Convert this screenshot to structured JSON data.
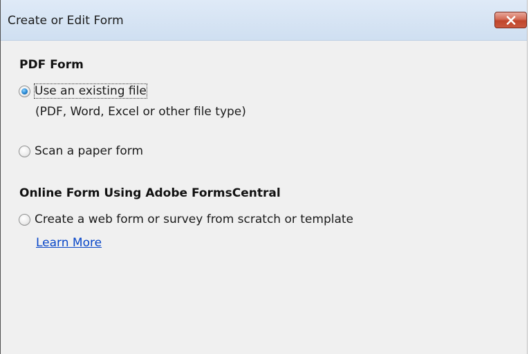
{
  "window": {
    "title": "Create or Edit Form",
    "close_icon": "close-icon"
  },
  "pdf_form": {
    "heading": "PDF Form",
    "options": [
      {
        "label": "Use an existing file",
        "description": "(PDF, Word, Excel or other file type)",
        "selected": true
      },
      {
        "label": "Scan a paper form",
        "selected": false
      }
    ]
  },
  "online_form": {
    "heading": "Online Form Using Adobe FormsCentral",
    "options": [
      {
        "label": "Create a web form or survey from scratch or template",
        "selected": false
      }
    ],
    "link_label": "Learn More"
  },
  "colors": {
    "titlebar": "#d6e4f4",
    "background": "#f0f0f0",
    "close_button": "#c9583e",
    "link": "#0645c8",
    "radio_selected": "#2a8ad4"
  }
}
